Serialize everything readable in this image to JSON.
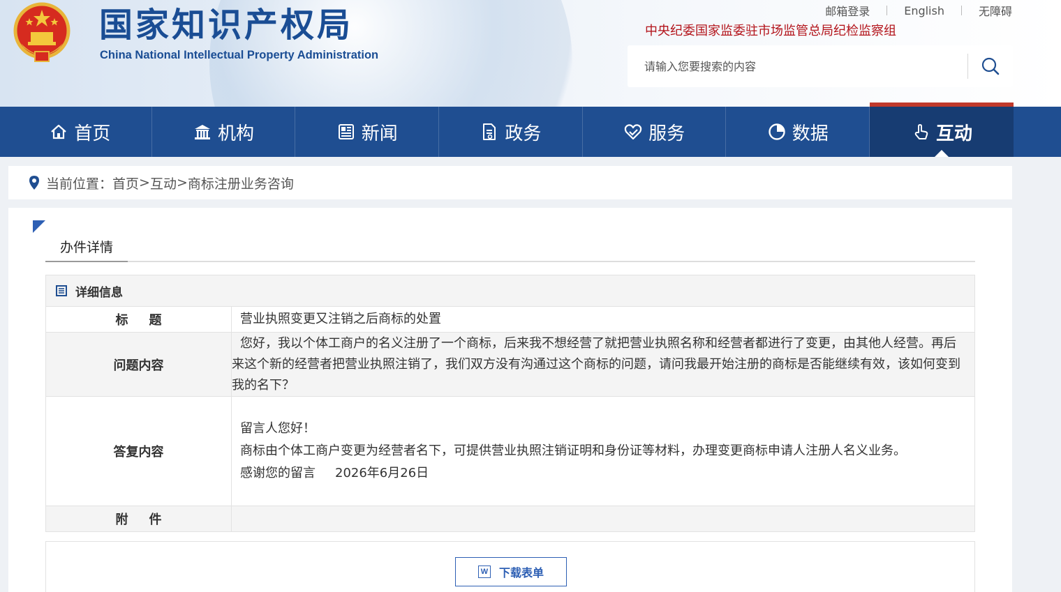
{
  "header": {
    "logo_cn": "国家知识产权局",
    "logo_en": "China National Intellectual Property Administration",
    "links": [
      "邮箱登录",
      "English",
      "无障碍"
    ],
    "org_line": "中央纪委国家监委驻市场监管总局纪检监察组",
    "search_placeholder": "请输入您要搜索的内容"
  },
  "nav": {
    "items": [
      {
        "label": "首页",
        "icon": "home-icon"
      },
      {
        "label": "机构",
        "icon": "institution-icon"
      },
      {
        "label": "新闻",
        "icon": "news-icon"
      },
      {
        "label": "政务",
        "icon": "document-icon"
      },
      {
        "label": "服务",
        "icon": "heart-service-icon"
      },
      {
        "label": "数据",
        "icon": "pie-chart-icon"
      },
      {
        "label": "互动",
        "icon": "hand-pointer-icon",
        "active": true
      }
    ]
  },
  "breadcrumb": {
    "prefix": "当前位置：",
    "items": [
      "首页",
      "互动",
      "商标注册业务咨询"
    ],
    "sep": ">"
  },
  "content": {
    "tab_label": "办件详情",
    "section_title": "详细信息",
    "rows": {
      "title_label": "标题",
      "title_value": "营业执照变更又注销之后商标的处置",
      "question_label": "问题内容",
      "question_value": "您好，我以个体工商户的名义注册了一个商标，后来我不想经营了就把营业执照名称和经营者都进行了变更，由其他人经营。再后来这个新的经营者把营业执照注销了，我们双方没有沟通过这个商标的问题，请问我最开始注册的商标是否能继续有效，该如何变到我的名下？",
      "answer_label": "答复内容",
      "answer_greeting": "留言人您好！",
      "answer_body": "商标由个体工商户变更为经营者名下，可提供营业执照注销证明和身份证等材料，办理变更商标申请人注册人名义业务。",
      "answer_thanks": "感谢您的留言",
      "answer_date": "2026年6月26日",
      "attachment_label": "附件"
    },
    "download_button": "下载表单"
  },
  "colors": {
    "nav_bg": "#1f4e91",
    "nav_active": "#173c72",
    "accent_red": "#b3141b",
    "brand_blue": "#1a4d94"
  }
}
